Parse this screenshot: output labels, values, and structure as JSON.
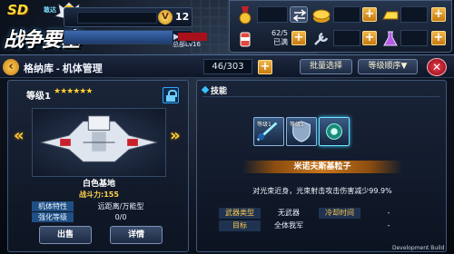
{
  "game": {
    "logo_title": "战争要塞",
    "logo_sd": "SD",
    "logo_sub": "敢达"
  },
  "player": {
    "vip_mark": "V",
    "vip_level": "12",
    "headquarters_label": "总部Lv16",
    "exp_fraction": 0.85
  },
  "resources": {
    "energy_count": "62/5",
    "energy_status": "已满"
  },
  "header": {
    "title": "格纳库 - 机体管理",
    "hangar_count": "46/303",
    "batch_select": "批量选择",
    "sort_order": "等级顺序▼",
    "back_glyph": "‹",
    "close_glyph": "✕"
  },
  "unit": {
    "level_label": "等级1",
    "stars": 6,
    "name": "白色基地",
    "power_label": "战斗力:155",
    "traits": [
      {
        "key": "机体特性",
        "value": "远距离/万能型"
      },
      {
        "key": "强化等级",
        "value": "0/0"
      }
    ],
    "sell_button": "出售",
    "detail_button": "详情",
    "left_arrow": "«",
    "right_arrow": "»"
  },
  "skills": {
    "section_label": "技能",
    "slots": [
      {
        "label": "等级1"
      },
      {
        "label": "等级1"
      },
      {
        "label": ""
      }
    ],
    "selected_name": "米诺夫斯基粒子",
    "description": "对光束近身，光束射击攻击伤害减少99.9%",
    "stats": {
      "weapon_type_key": "武器类型",
      "weapon_type_value": "无武器",
      "cooldown_key": "冷却时间",
      "cooldown_value": "-",
      "target_key": "目标",
      "target_value": "全体我军",
      "extra_value": "-"
    }
  },
  "footer": {
    "build_label": "Development Build"
  },
  "colors": {
    "accent_gold": "#ffce3a",
    "panel_blue": "#1f4f84",
    "close_red": "#e93c4c"
  }
}
